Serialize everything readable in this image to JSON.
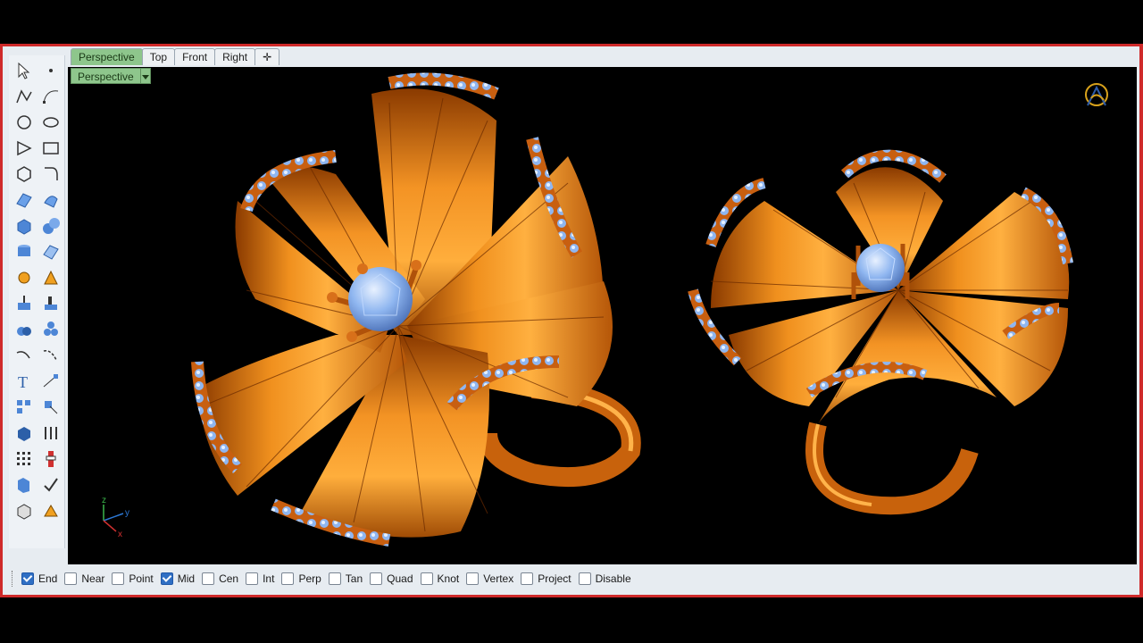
{
  "viewport_tabs": [
    {
      "label": "Perspective",
      "active": true
    },
    {
      "label": "Top",
      "active": false
    },
    {
      "label": "Front",
      "active": false
    },
    {
      "label": "Right",
      "active": false
    }
  ],
  "viewport": {
    "title": "Perspective",
    "axes": {
      "z": "z",
      "y": "y",
      "x": "x"
    }
  },
  "osnaps": [
    {
      "label": "End",
      "checked": true
    },
    {
      "label": "Near",
      "checked": false
    },
    {
      "label": "Point",
      "checked": false
    },
    {
      "label": "Mid",
      "checked": true
    },
    {
      "label": "Cen",
      "checked": false
    },
    {
      "label": "Int",
      "checked": false
    },
    {
      "label": "Perp",
      "checked": false
    },
    {
      "label": "Tan",
      "checked": false
    },
    {
      "label": "Quad",
      "checked": false
    },
    {
      "label": "Knot",
      "checked": false
    },
    {
      "label": "Vertex",
      "checked": false
    },
    {
      "label": "Project",
      "checked": false
    },
    {
      "label": "Disable",
      "checked": false
    }
  ],
  "toolbar_icons": [
    "select-arrow-icon",
    "point-icon",
    "polyline-icon",
    "curve-control-points-icon",
    "circle-icon",
    "ellipse-icon",
    "polygon-icon",
    "rectangle-icon",
    "curve-tools-icon",
    "fillet-curve-icon",
    "surface-icon",
    "surface-tools-icon",
    "box-solid-icon",
    "sphere-solid-icon",
    "cylinder-icon",
    "mesh-icon",
    "gear-tools-icon",
    "analyze-icon",
    "extrude-icon",
    "boolean-icon",
    "join-icon",
    "explode-icon",
    "offset-curve-icon",
    "blend-curve-icon",
    "text-icon",
    "dimension-icon",
    "array-icon",
    "transform-icon",
    "render-icon",
    "layer-icon",
    "grid-icon",
    "check-icon",
    "properties-icon",
    "checkmark-icon",
    "solid-edit-icon",
    "paint-icon"
  ],
  "colors": {
    "window_border": "#cf2a2a",
    "active_tab": "#8ec68c",
    "metal": "#e8781a",
    "gem": "#8fb6f0"
  }
}
